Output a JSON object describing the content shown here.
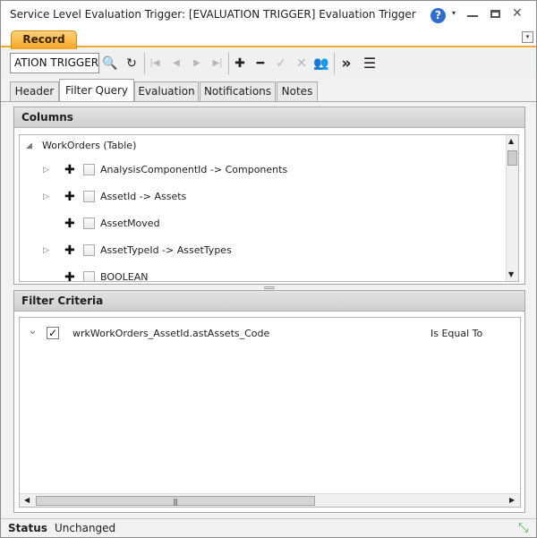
{
  "window": {
    "title": "Service Level Evaluation Trigger: [EVALUATION TRIGGER] Evaluation Trigger",
    "help_glyph": "?",
    "dropdown_glyph": "▾",
    "close_glyph": "✕"
  },
  "record_tab": {
    "label": "Record",
    "menu_glyph": "▾"
  },
  "toolbar": {
    "code_value": "ATION TRIGGER",
    "search_glyph": "🔍",
    "refresh_glyph": "↻",
    "first_glyph": "|◀",
    "prev_glyph": "◀",
    "next_glyph": "▶",
    "last_glyph": "▶|",
    "add_glyph": "✚",
    "remove_glyph": "━",
    "confirm_glyph": "✓",
    "cancel_glyph": "✕",
    "users_glyph": "👥",
    "more_glyph": "»",
    "list_glyph": "☰"
  },
  "tabs": [
    {
      "label": "Header"
    },
    {
      "label": "Filter Query"
    },
    {
      "label": "Evaluation"
    },
    {
      "label": "Notifications"
    },
    {
      "label": "Notes"
    }
  ],
  "active_tab": "Filter Query",
  "columns": {
    "title": "Columns",
    "root": {
      "label": "WorkOrders (Table)",
      "expander": "◢"
    },
    "items": [
      {
        "label": "AnalysisComponentId -> Components",
        "expander": "▷",
        "plus": "✚"
      },
      {
        "label": "AssetId -> Assets",
        "expander": "▷",
        "plus": "✚"
      },
      {
        "label": "AssetMoved",
        "expander": "",
        "plus": "✚"
      },
      {
        "label": "AssetTypeId -> AssetTypes",
        "expander": "▷",
        "plus": "✚"
      },
      {
        "label": "BOOLEAN",
        "expander": "",
        "plus": "✚"
      }
    ],
    "scroll_up": "▲",
    "scroll_down": "▼"
  },
  "filter_criteria": {
    "title": "Filter Criteria",
    "rows": [
      {
        "expander": "⌄",
        "check": "✓",
        "field": "wrkWorkOrders_AssetId.astAssets_Code",
        "operator": "Is Equal To"
      }
    ],
    "scroll_left": "◀",
    "scroll_right": "▶",
    "thumb_grip": "|||"
  },
  "status": {
    "label": "Status",
    "value": "Unchanged",
    "resize_glyph": "⤡"
  }
}
